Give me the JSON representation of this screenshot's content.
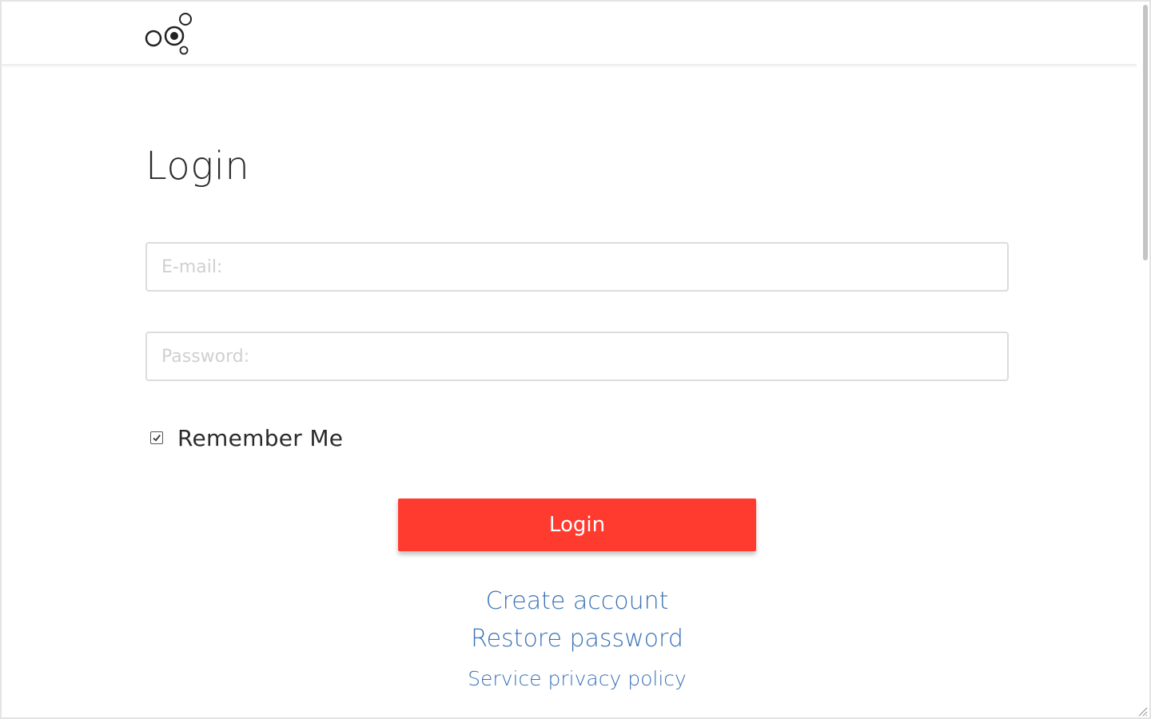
{
  "page": {
    "title": "Login"
  },
  "form": {
    "email_placeholder": "E-mail:",
    "email_value": "",
    "password_placeholder": "Password:",
    "password_value": "",
    "remember_label": "Remember Me",
    "remember_checked": true,
    "submit_label": "Login"
  },
  "links": {
    "create_account": "Create account",
    "restore_password": "Restore password",
    "privacy_policy": "Service privacy policy"
  },
  "icons": {
    "logo": "circles-logo-icon",
    "checkbox": "checkmark-icon",
    "resize": "resize-grip-icon"
  },
  "colors": {
    "accent": "#ff3b30",
    "link": "#3a72b5",
    "text": "#2b2b2b",
    "border": "#dcdcdc",
    "placeholder": "#d0d0d0"
  }
}
